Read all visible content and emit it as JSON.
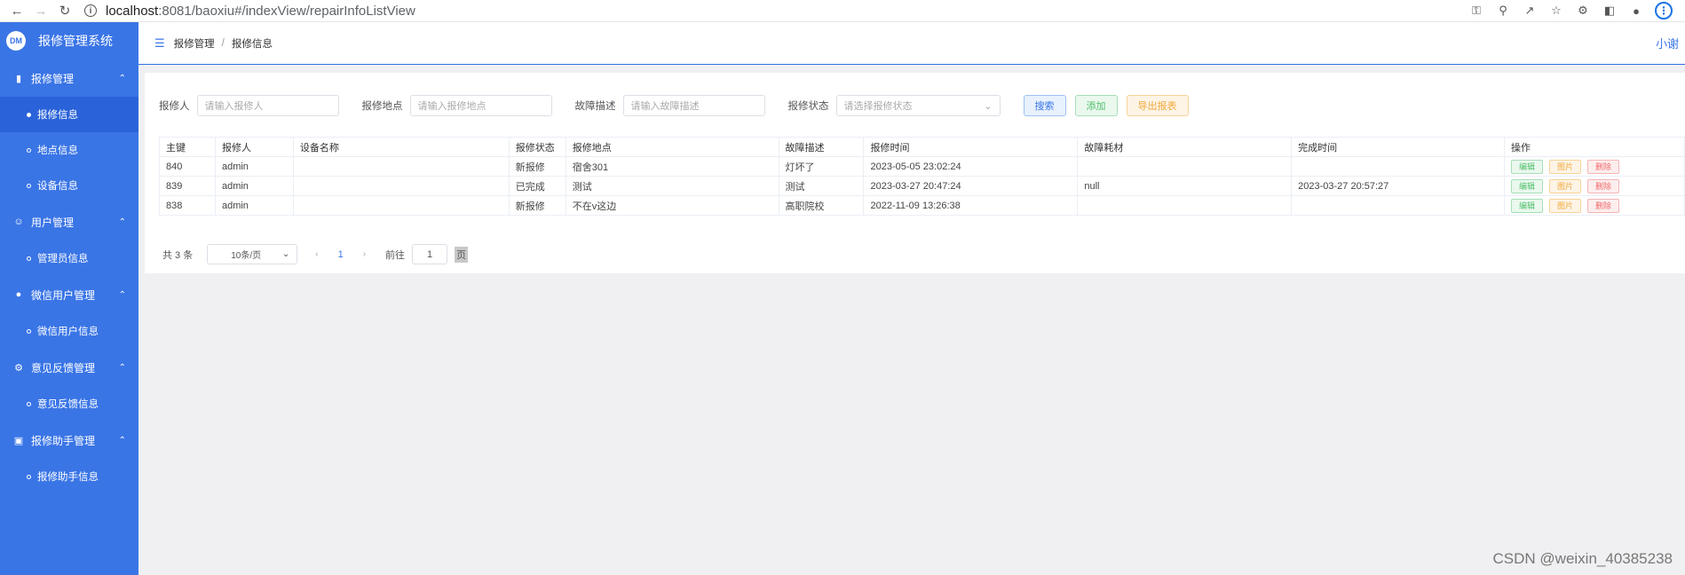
{
  "browser": {
    "host": "localhost",
    "path": ":8081/baoxiu#/indexView/repairInfoListView"
  },
  "app": {
    "logo_abbr": "DM",
    "title": "报修管理系统",
    "accent": "#3a75e6"
  },
  "sidebar": {
    "groups": [
      {
        "label": "报修管理",
        "icon": "chart-icon",
        "items": [
          "报修信息",
          "地点信息",
          "设备信息"
        ]
      },
      {
        "label": "用户管理",
        "icon": "user-icon",
        "items": [
          "管理员信息"
        ]
      },
      {
        "label": "微信用户管理",
        "icon": "person-icon",
        "items": [
          "微信用户信息"
        ]
      },
      {
        "label": "意见反馈管理",
        "icon": "gear-icon",
        "items": [
          "意见反馈信息"
        ]
      },
      {
        "label": "报修助手管理",
        "icon": "box-icon",
        "items": [
          "报修助手信息"
        ]
      }
    ],
    "active_item": "报修信息"
  },
  "topbar": {
    "breadcrumb": [
      "报修管理",
      "报修信息"
    ],
    "user": "小谢"
  },
  "search": {
    "reporter_label": "报修人",
    "reporter_placeholder": "请输入报修人",
    "location_label": "报修地点",
    "location_placeholder": "请输入报修地点",
    "fault_label": "故障描述",
    "fault_placeholder": "请输入故障描述",
    "status_label": "报修状态",
    "status_placeholder": "请选择报修状态",
    "search_btn": "搜索",
    "add_btn": "添加",
    "export_btn": "导出报表"
  },
  "table": {
    "headers": [
      "主键",
      "报修人",
      "设备名称",
      "报修状态",
      "报修地点",
      "故障描述",
      "报修时间",
      "故障耗材",
      "完成时间",
      "操作"
    ],
    "rows": [
      [
        "840",
        "admin",
        "",
        "新报修",
        "宿舍301",
        "灯坏了",
        "2023-05-05 23:02:24",
        "",
        ""
      ],
      [
        "839",
        "admin",
        "",
        "已完成",
        "测试",
        "测试",
        "2023-03-27 20:47:24",
        "null",
        "2023-03-27 20:57:27"
      ],
      [
        "838",
        "admin",
        "",
        "新报修",
        "不在v这边",
        "高职院校",
        "2022-11-09 13:26:38",
        "",
        ""
      ]
    ],
    "actions": {
      "edit": "编辑",
      "image": "图片",
      "delete": "删除"
    }
  },
  "pager": {
    "total": "共 3 条",
    "page_size": "10条/页",
    "current_page": "1",
    "goto_label": "前往",
    "goto_value": "1",
    "page_word": "页"
  },
  "watermark": "CSDN @weixin_40385238"
}
